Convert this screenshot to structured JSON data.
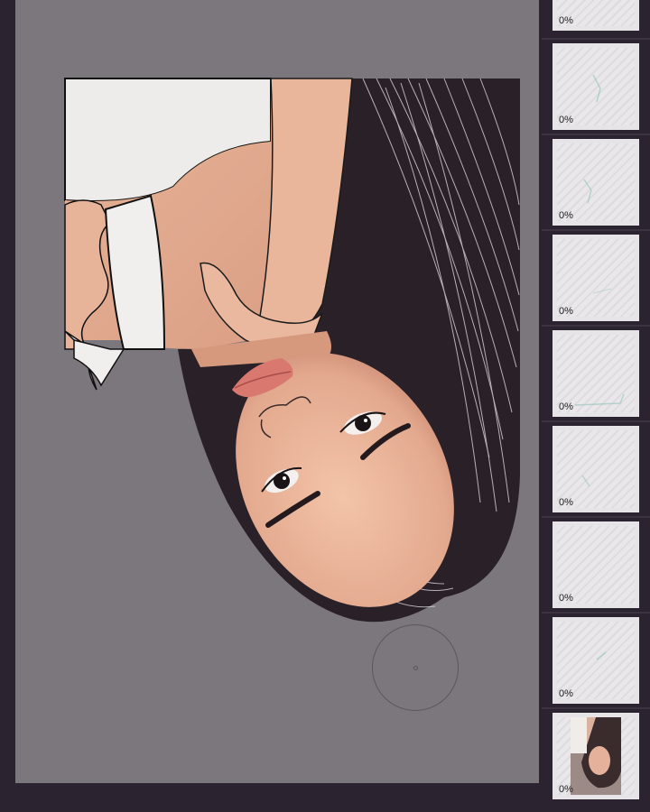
{
  "canvas": {
    "background": "#7b777c",
    "brush_cursor": "brush-size-circle"
  },
  "layers": [
    {
      "opacity": "0%",
      "content": "blank"
    },
    {
      "opacity": "0%",
      "content": "faint-strokes"
    },
    {
      "opacity": "0%",
      "content": "faint-strokes"
    },
    {
      "opacity": "0%",
      "content": "faint-strokes"
    },
    {
      "opacity": "0%",
      "content": "faint-strokes"
    },
    {
      "opacity": "0%",
      "content": "faint-strokes"
    },
    {
      "opacity": "0%",
      "content": "blank"
    },
    {
      "opacity": "0%",
      "content": "faint-strokes"
    },
    {
      "opacity": "0%",
      "content": "photo-reference"
    }
  ],
  "colors": {
    "panel_bg": "#2b2430",
    "hair": "#2a2028",
    "skin": "#e8b59a",
    "shirt": "#eeeceb"
  }
}
